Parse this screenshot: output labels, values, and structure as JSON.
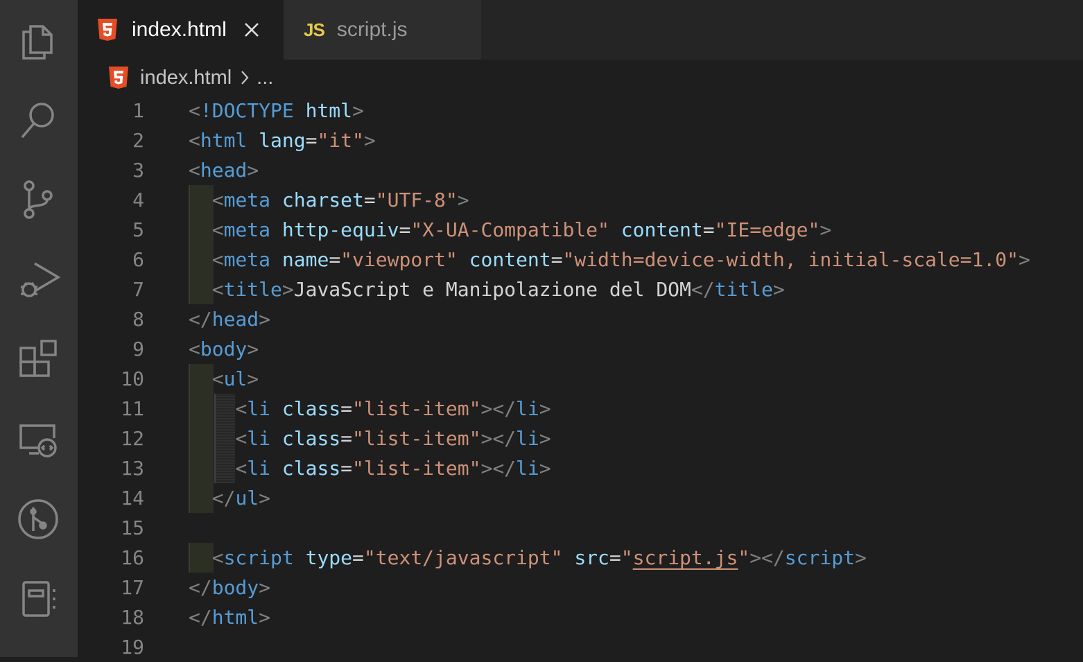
{
  "activity_bar": {
    "icons": [
      "files-icon",
      "search-icon",
      "source-control-icon",
      "run-debug-icon",
      "extensions-icon",
      "remote-explorer-icon",
      "git-graph-icon",
      "notebook-icon"
    ]
  },
  "tabs": [
    {
      "label": "index.html",
      "icon": "html5-icon",
      "active": true
    },
    {
      "label": "script.js",
      "icon": "js-icon",
      "badge": "JS",
      "active": false
    }
  ],
  "breadcrumb": {
    "file": "index.html",
    "ellipsis": "..."
  },
  "colors": {
    "tag": "#569cd6",
    "attr": "#9cdcfe",
    "string": "#ce9178",
    "punct": "#808080",
    "text": "#d4d4d4",
    "line_number": "#858585",
    "html5": "#e44d26",
    "js": "#e8c94a"
  },
  "editor": {
    "lines": [
      {
        "n": "1",
        "tokens": [
          [
            "t",
            "<"
          ],
          [
            "k",
            "!DOCTYPE"
          ],
          [
            "txt",
            " "
          ],
          [
            "a",
            "html"
          ],
          [
            "t",
            ">"
          ]
        ]
      },
      {
        "n": "2",
        "tokens": [
          [
            "t",
            "<"
          ],
          [
            "k",
            "html"
          ],
          [
            "txt",
            " "
          ],
          [
            "a",
            "lang"
          ],
          [
            "txt",
            "="
          ],
          [
            "s",
            "\"it\""
          ],
          [
            "t",
            ">"
          ]
        ]
      },
      {
        "n": "3",
        "tokens": [
          [
            "t",
            "<"
          ],
          [
            "k",
            "head"
          ],
          [
            "t",
            ">"
          ]
        ]
      },
      {
        "n": "4",
        "tokens": [
          [
            "txt",
            "  "
          ],
          [
            "t",
            "<"
          ],
          [
            "k",
            "meta"
          ],
          [
            "txt",
            " "
          ],
          [
            "a",
            "charset"
          ],
          [
            "txt",
            "="
          ],
          [
            "s",
            "\"UTF-8\""
          ],
          [
            "t",
            ">"
          ]
        ]
      },
      {
        "n": "5",
        "tokens": [
          [
            "txt",
            "  "
          ],
          [
            "t",
            "<"
          ],
          [
            "k",
            "meta"
          ],
          [
            "txt",
            " "
          ],
          [
            "a",
            "http-equiv"
          ],
          [
            "txt",
            "="
          ],
          [
            "s",
            "\"X-UA-Compatible\""
          ],
          [
            "txt",
            " "
          ],
          [
            "a",
            "content"
          ],
          [
            "txt",
            "="
          ],
          [
            "s",
            "\"IE=edge\""
          ],
          [
            "t",
            ">"
          ]
        ]
      },
      {
        "n": "6",
        "tokens": [
          [
            "txt",
            "  "
          ],
          [
            "t",
            "<"
          ],
          [
            "k",
            "meta"
          ],
          [
            "txt",
            " "
          ],
          [
            "a",
            "name"
          ],
          [
            "txt",
            "="
          ],
          [
            "s",
            "\"viewport\""
          ],
          [
            "txt",
            " "
          ],
          [
            "a",
            "content"
          ],
          [
            "txt",
            "="
          ],
          [
            "s",
            "\"width=device-width, initial-scale=1.0\""
          ],
          [
            "t",
            ">"
          ]
        ]
      },
      {
        "n": "7",
        "tokens": [
          [
            "txt",
            "  "
          ],
          [
            "t",
            "<"
          ],
          [
            "k",
            "title"
          ],
          [
            "t",
            ">"
          ],
          [
            "txt",
            "JavaScript e Manipolazione del DOM"
          ],
          [
            "t",
            "</"
          ],
          [
            "k",
            "title"
          ],
          [
            "t",
            ">"
          ]
        ]
      },
      {
        "n": "8",
        "tokens": [
          [
            "t",
            "</"
          ],
          [
            "k",
            "head"
          ],
          [
            "t",
            ">"
          ]
        ]
      },
      {
        "n": "9",
        "tokens": [
          [
            "t",
            "<"
          ],
          [
            "k",
            "body"
          ],
          [
            "t",
            ">"
          ]
        ]
      },
      {
        "n": "10",
        "tokens": [
          [
            "txt",
            "  "
          ],
          [
            "t",
            "<"
          ],
          [
            "k",
            "ul"
          ],
          [
            "t",
            ">"
          ]
        ]
      },
      {
        "n": "11",
        "tokens": [
          [
            "txt",
            "    "
          ],
          [
            "t",
            "<"
          ],
          [
            "k",
            "li"
          ],
          [
            "txt",
            " "
          ],
          [
            "a",
            "class"
          ],
          [
            "txt",
            "="
          ],
          [
            "s",
            "\"list-item\""
          ],
          [
            "t",
            "></"
          ],
          [
            "k",
            "li"
          ],
          [
            "t",
            ">"
          ]
        ]
      },
      {
        "n": "12",
        "tokens": [
          [
            "txt",
            "    "
          ],
          [
            "t",
            "<"
          ],
          [
            "k",
            "li"
          ],
          [
            "txt",
            " "
          ],
          [
            "a",
            "class"
          ],
          [
            "txt",
            "="
          ],
          [
            "s",
            "\"list-item\""
          ],
          [
            "t",
            "></"
          ],
          [
            "k",
            "li"
          ],
          [
            "t",
            ">"
          ]
        ]
      },
      {
        "n": "13",
        "tokens": [
          [
            "txt",
            "    "
          ],
          [
            "t",
            "<"
          ],
          [
            "k",
            "li"
          ],
          [
            "txt",
            " "
          ],
          [
            "a",
            "class"
          ],
          [
            "txt",
            "="
          ],
          [
            "s",
            "\"list-item\""
          ],
          [
            "t",
            "></"
          ],
          [
            "k",
            "li"
          ],
          [
            "t",
            ">"
          ]
        ]
      },
      {
        "n": "14",
        "tokens": [
          [
            "txt",
            "  "
          ],
          [
            "t",
            "</"
          ],
          [
            "k",
            "ul"
          ],
          [
            "t",
            ">"
          ]
        ]
      },
      {
        "n": "15",
        "tokens": []
      },
      {
        "n": "16",
        "tokens": [
          [
            "txt",
            "  "
          ],
          [
            "t",
            "<"
          ],
          [
            "k",
            "script"
          ],
          [
            "txt",
            " "
          ],
          [
            "a",
            "type"
          ],
          [
            "txt",
            "="
          ],
          [
            "s",
            "\"text/javascript\""
          ],
          [
            "txt",
            " "
          ],
          [
            "a",
            "src"
          ],
          [
            "txt",
            "="
          ],
          [
            "s",
            "\""
          ],
          [
            "s u",
            "script.js"
          ],
          [
            "s",
            "\""
          ],
          [
            "t",
            "></"
          ],
          [
            "k",
            "script"
          ],
          [
            "t",
            ">"
          ]
        ]
      },
      {
        "n": "17",
        "tokens": [
          [
            "t",
            "</"
          ],
          [
            "k",
            "body"
          ],
          [
            "t",
            ">"
          ]
        ]
      },
      {
        "n": "18",
        "tokens": [
          [
            "t",
            "</"
          ],
          [
            "k",
            "html"
          ],
          [
            "t",
            ">"
          ]
        ]
      },
      {
        "n": "19",
        "tokens": []
      }
    ]
  }
}
